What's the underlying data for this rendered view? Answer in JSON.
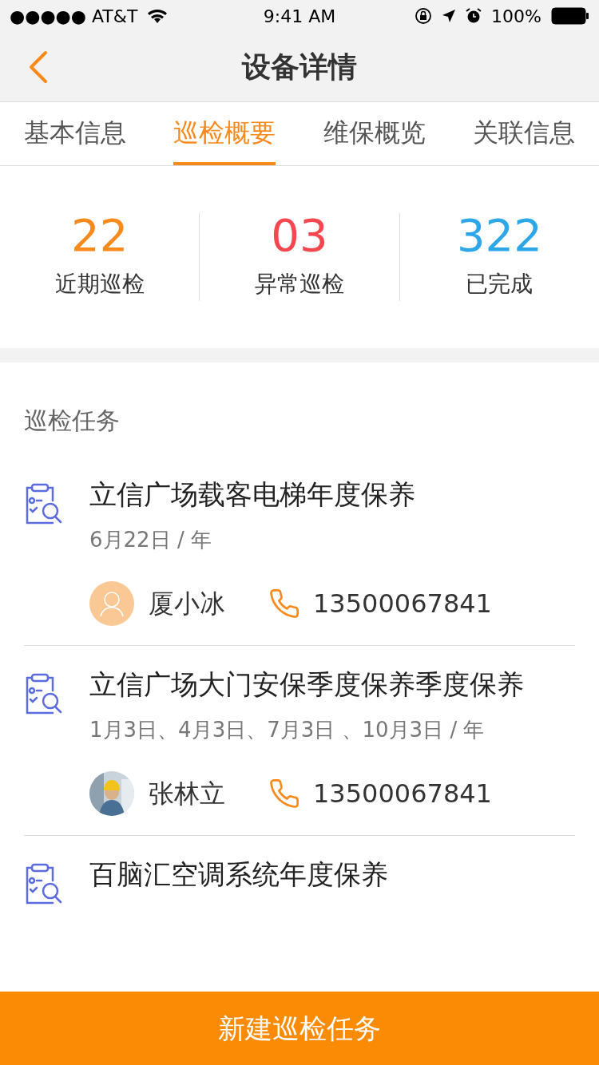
{
  "status_bar": {
    "carrier": "●●●●● AT&T",
    "time": "9:41 AM",
    "battery": "100%"
  },
  "nav": {
    "title": "设备详情"
  },
  "tabs": [
    {
      "label": "基本信息",
      "selected": false
    },
    {
      "label": "巡检概要",
      "selected": true
    },
    {
      "label": "维保概览",
      "selected": false
    },
    {
      "label": "关联信息",
      "selected": false
    }
  ],
  "stats": [
    {
      "value": "22",
      "label": "近期巡检",
      "color": "#fb8a1c"
    },
    {
      "value": "03",
      "label": "异常巡检",
      "color": "#f5474f"
    },
    {
      "value": "322",
      "label": "已完成",
      "color": "#2ea7e8"
    }
  ],
  "section": {
    "title": "巡检任务"
  },
  "tasks": [
    {
      "title": "立信广场载客电梯年度保养",
      "schedule": "6月22日 / 年",
      "person": {
        "name": "厦小冰",
        "avatar": {
          "kind": "placeholder"
        }
      },
      "phone": "13500067841"
    },
    {
      "title": "立信广场大门安保季度保养季度保养",
      "schedule": "1月3日、4月3日、7月3日 、10月3日 / 年",
      "person": {
        "name": "张林立"
      },
      "phone": "13500067841"
    },
    {
      "title": "百脑汇空调系统年度保养"
    }
  ],
  "bottom_button": {
    "label": "新建巡检任务"
  }
}
